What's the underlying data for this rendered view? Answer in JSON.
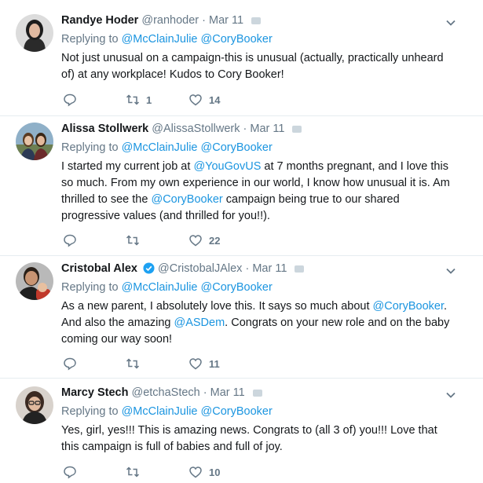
{
  "tweets": [
    {
      "name": "Randye Hoder",
      "handle": "@ranhoder",
      "date": "Mar 11",
      "replying_prefix": "Replying to",
      "replying": [
        "@McClainJulie",
        "@CoryBooker"
      ],
      "text": "Not just unusual on a campaign-this is unusual (actually, practically unheard of) at any workplace! Kudos to Cory Booker!",
      "retweets": "1",
      "likes": "14",
      "verified": false,
      "avatar_icon": "avatar-woman-dark-hair"
    },
    {
      "name": "Alissa Stollwerk",
      "handle": "@AlissaStollwerk",
      "date": "Mar 11",
      "replying_prefix": "Replying to",
      "replying": [
        "@McClainJulie",
        "@CoryBooker"
      ],
      "text_parts": {
        "a": "I started my current job at ",
        "m1": "@YouGovUS",
        "b": " at 7 months pregnant, and I love this so much. From my own experience in our world, I know how unusual it is. Am thrilled to see the ",
        "m2": "@CoryBooker",
        "c": " campaign being true to our shared progressive values (and thrilled for you!!)."
      },
      "retweets": "",
      "likes": "22",
      "verified": false,
      "avatar_icon": "avatar-woman-outdoors"
    },
    {
      "name": "Cristobal Alex",
      "handle": "@CristobalJAlex",
      "date": "Mar 11",
      "replying_prefix": "Replying to",
      "replying": [
        "@McClainJulie",
        "@CoryBooker"
      ],
      "text_parts": {
        "a": "As a new parent, I absolutely love this. It says so much about ",
        "m1": "@CoryBooker",
        "b": ". And also the amazing ",
        "m2": "@ASDem",
        "c": ". Congrats on your new role and on the baby coming our way soon!"
      },
      "retweets": "",
      "likes": "11",
      "verified": true,
      "avatar_icon": "avatar-man-with-baby"
    },
    {
      "name": "Marcy Stech",
      "handle": "@etchaStech",
      "date": "Mar 11",
      "replying_prefix": "Replying to",
      "replying": [
        "@McClainJulie",
        "@CoryBooker"
      ],
      "text": "Yes, girl, yes!!! This is amazing news. Congrats to (all 3 of) you!!! Love that this campaign is full of babies and full of joy.",
      "retweets": "",
      "likes": "10",
      "verified": false,
      "avatar_icon": "avatar-woman-glasses"
    }
  ],
  "dot": "·",
  "colors": {
    "link": "#1b95e0",
    "muted": "#657786",
    "text": "#14171a",
    "divider": "#e6ecf0"
  }
}
